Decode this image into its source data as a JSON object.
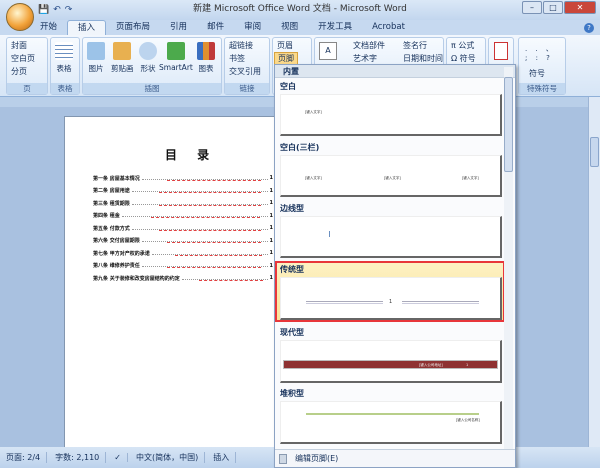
{
  "title": "新建 Microsoft Office Word 文档 - Microsoft Word",
  "tabs": [
    "开始",
    "插入",
    "页面布局",
    "引用",
    "邮件",
    "审阅",
    "视图",
    "开发工具",
    "Acrobat"
  ],
  "active_tab": "插入",
  "ribbon": {
    "page_group": {
      "label": "页",
      "items": [
        "封面",
        "空白页",
        "分页"
      ]
    },
    "table_group": {
      "label": "表格",
      "items": [
        "表格"
      ]
    },
    "illus_group": {
      "label": "插图",
      "items": [
        "图片",
        "剪贴画",
        "形状",
        "SmartArt",
        "图表"
      ]
    },
    "link_group": {
      "label": "链接",
      "items": [
        "超链接",
        "书签",
        "交叉引用"
      ]
    },
    "hf_group": {
      "items": [
        "页眉",
        "页脚"
      ]
    },
    "text_group": {
      "items": [
        "文档部件",
        "艺术字",
        "签名行",
        "日期和时间"
      ]
    },
    "symbol_group": {
      "items": [
        "公式",
        "符号"
      ]
    },
    "special_group": {
      "label": "特殊符号",
      "items": [
        "符号"
      ],
      "chars": ". . 、 ; : ?"
    }
  },
  "doc": {
    "title": "目 录",
    "toc": [
      {
        "text": "第一条 房屋基本情况",
        "page": "1"
      },
      {
        "text": "第二条 房屋用途",
        "page": "1"
      },
      {
        "text": "第三条 租赁期限",
        "page": "1"
      },
      {
        "text": "第四条 租金",
        "page": "1"
      },
      {
        "text": "第五条 付款方式",
        "page": "1"
      },
      {
        "text": "第六条 交付房屋期限",
        "page": "1"
      },
      {
        "text": "第七条 甲方对产权的承诺",
        "page": "1"
      },
      {
        "text": "第八条 维修养护责任",
        "page": "1"
      },
      {
        "text": "第九条 关于装修和改变房屋结构的约定",
        "page": "1"
      }
    ]
  },
  "footer_menu": {
    "header": "内置",
    "sections": [
      "空白",
      "空白(三栏)",
      "边线型",
      "传统型",
      "现代型",
      "堆积型"
    ],
    "placeholder": "[键入文字]",
    "modern_placeholder": "[键入公司地址]",
    "stacked_placeholder": "[键入公司名称]",
    "page_num": "1",
    "edit_footer": "编辑页脚(E)",
    "selected": "传统型"
  },
  "status": {
    "page": "页面: 2/4",
    "words": "字数: 2,110",
    "lang": "中文(简体，中国)",
    "mode": "插入"
  }
}
